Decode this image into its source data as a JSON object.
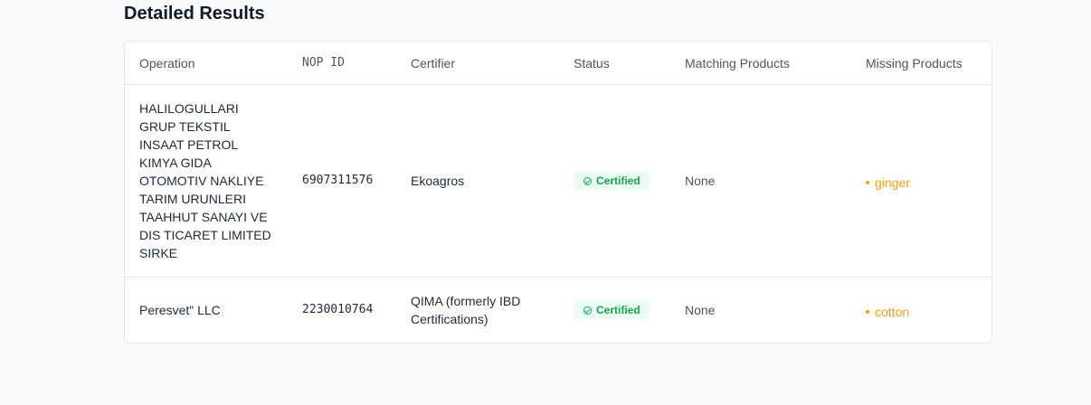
{
  "section": {
    "title": "Detailed Results"
  },
  "table": {
    "headers": {
      "operation": "Operation",
      "nop_id": "NOP ID",
      "certifier": "Certifier",
      "status": "Status",
      "matching": "Matching Products",
      "missing": "Missing Products"
    },
    "rows": [
      {
        "operation": "HALILOGULLARI GRUP TEKSTIL INSAAT PETROL KIMYA GIDA OTOMOTIV NAKLIYE TARIM URUNLERI TAAHHUT SANAYI VE DIS TICARET LIMITED SIRKE",
        "nop_id": "6907311576",
        "certifier": "Ekoagros",
        "status": "Certified",
        "matching": "None",
        "missing": "ginger"
      },
      {
        "operation": "Peresvet\" LLC",
        "nop_id": "2230010764",
        "certifier": "QIMA (formerly IBD Certifications)",
        "status": "Certified",
        "matching": "None",
        "missing": "cotton"
      }
    ]
  },
  "colors": {
    "status_certified": "#16a34a",
    "missing_product": "#f59e0b"
  }
}
